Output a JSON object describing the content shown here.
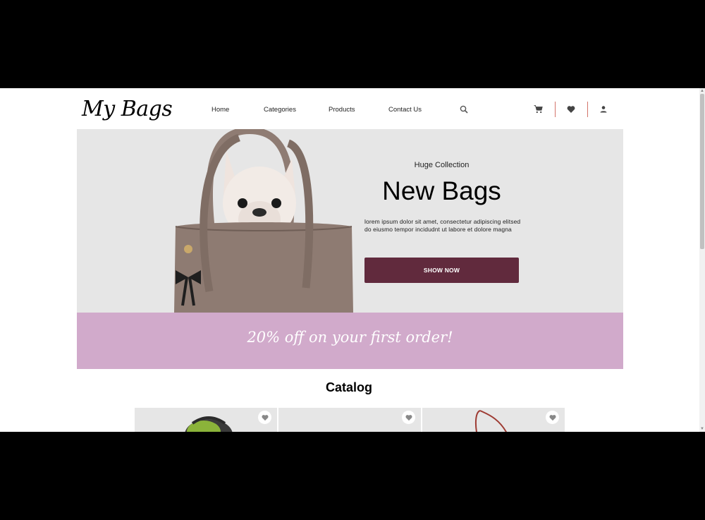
{
  "brand": {
    "logo": "My Bags"
  },
  "nav": {
    "home": "Home",
    "categories": "Categories",
    "products": "Products",
    "contact": "Contact Us"
  },
  "header_icons": [
    "search-icon",
    "cart-icon",
    "heart-icon",
    "user-icon"
  ],
  "hero": {
    "subtitle": "Huge Collection",
    "title": "New Bags",
    "description": "lorem ipsum dolor sit amet, consectetur adipiscing elitsed do eiusmo tempor incidudnt ut labore et dolore magna",
    "button": "SHOW NOW"
  },
  "promo": {
    "text": "20% off on your first order!"
  },
  "catalog": {
    "title": "Catalog",
    "cards": [
      "card-1",
      "card-2",
      "card-3"
    ]
  },
  "colors": {
    "accent": "#612a3d",
    "promo_bg": "#d1aacb",
    "hero_bg": "#e6e6e6",
    "divider": "#c0392b"
  }
}
